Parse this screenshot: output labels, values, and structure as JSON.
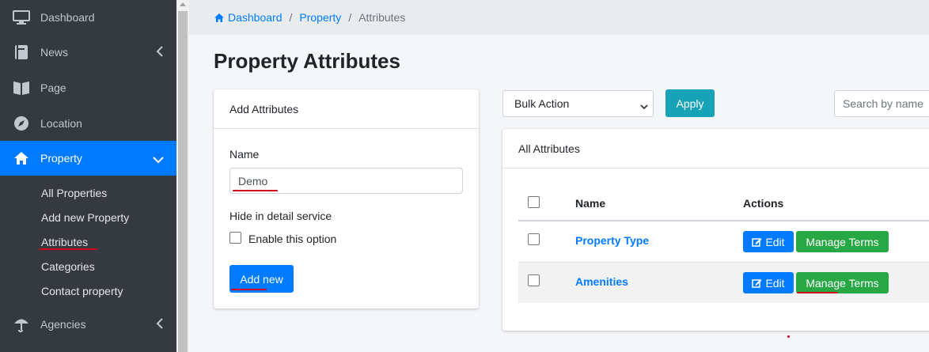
{
  "sidebar": {
    "items": [
      {
        "label": "Dashboard",
        "icon": "desktop-icon"
      },
      {
        "label": "News",
        "icon": "book-icon"
      },
      {
        "label": "Page",
        "icon": "book-open-icon"
      },
      {
        "label": "Location",
        "icon": "compass-icon"
      },
      {
        "label": "Property",
        "icon": "home-icon"
      },
      {
        "label": "Agencies",
        "icon": "umbrella-icon"
      }
    ],
    "subitems": [
      "All Properties",
      "Add new Property",
      "Attributes",
      "Categories",
      "Contact property"
    ]
  },
  "breadcrumb": {
    "home": "Dashboard",
    "property": "Property",
    "current": "Attributes"
  },
  "page_title": "Property Attributes",
  "add_form": {
    "header": "Add Attributes",
    "name_label": "Name",
    "name_value": "Demo",
    "hide_label": "Hide in detail service",
    "option_label": "Enable this option",
    "submit_label": "Add new"
  },
  "toolbar": {
    "bulk_action": "Bulk Action",
    "apply_label": "Apply",
    "search_placeholder": "Search by name"
  },
  "list": {
    "header": "All Attributes",
    "columns": {
      "name": "Name",
      "actions": "Actions"
    },
    "rows": [
      {
        "name": "Property Type",
        "edit": "Edit",
        "manage": "Manage Terms"
      },
      {
        "name": "Amenities",
        "edit": "Edit",
        "manage": "Manage Terms"
      }
    ]
  },
  "colors": {
    "sidebar_bg": "#343a40",
    "active_bg": "#007bff",
    "info": "#17a2b8",
    "success": "#28a745",
    "annotation": "#d0021b"
  }
}
